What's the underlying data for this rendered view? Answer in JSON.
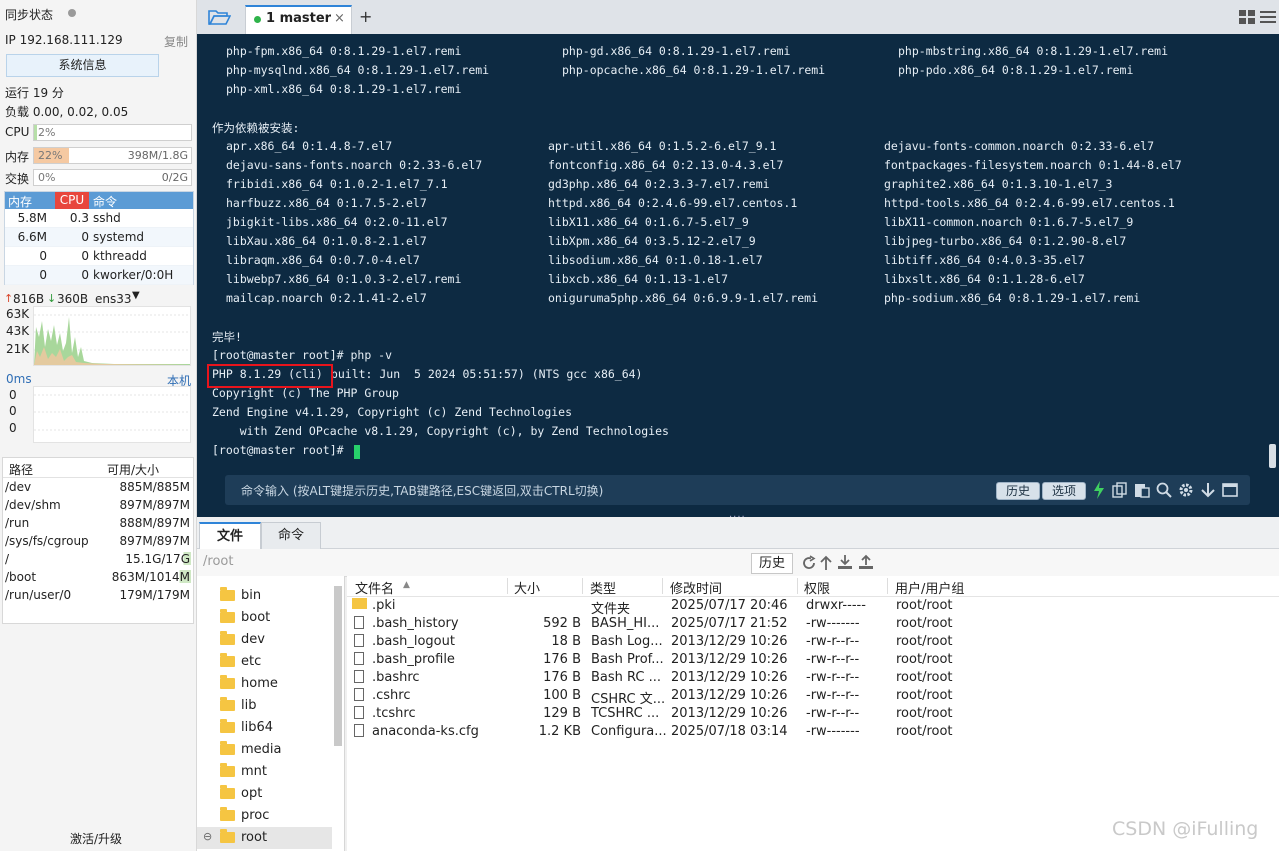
{
  "left": {
    "sync_label": "同步状态",
    "ip": "IP 192.168.111.129",
    "copy": "复制",
    "sysinfo_btn": "系统信息",
    "uptime": "运行 19 分",
    "load": "负载 0.00, 0.02, 0.05",
    "cpu_label": "CPU",
    "cpu_val": "2%",
    "mem_label": "内存",
    "mem_val": "22%",
    "mem_size": "398M/1.8G",
    "swap_label": "交换",
    "swap_val": "0%",
    "swap_size": "0/2G",
    "proc_headers": [
      "内存",
      "CPU",
      "命令"
    ],
    "procs": [
      {
        "mem": "5.8M",
        "cpu": "0.3",
        "cmd": "sshd"
      },
      {
        "mem": "6.6M",
        "cpu": "0",
        "cmd": "systemd"
      },
      {
        "mem": "0",
        "cpu": "0",
        "cmd": "kthreadd"
      },
      {
        "mem": "0",
        "cpu": "0",
        "cmd": "kworker/0:0H"
      }
    ],
    "net_up": "816B",
    "net_down": "360B",
    "net_iface": "ens33",
    "net_ticks": [
      "63K",
      "43K",
      "21K"
    ],
    "lat_label": "0ms",
    "lat_host": "本机",
    "lat_ticks": [
      "0",
      "0",
      "0"
    ],
    "disk_headers": [
      "路径",
      "可用/大小"
    ],
    "disks": [
      {
        "path": "/dev",
        "size": "885M/885M"
      },
      {
        "path": "/dev/shm",
        "size": "897M/897M"
      },
      {
        "path": "/run",
        "size": "888M/897M"
      },
      {
        "path": "/sys/fs/cgroup",
        "size": "897M/897M"
      },
      {
        "path": "/",
        "size": "15.1G/17G"
      },
      {
        "path": "/boot",
        "size": "863M/1014M"
      },
      {
        "path": "/run/user/0",
        "size": "179M/179M"
      }
    ],
    "activate": "激活/升级"
  },
  "tabs": {
    "active_label": "1 master",
    "close": "×",
    "add": "+"
  },
  "terminal": {
    "pkg_rows1": [
      [
        "php-fpm.x86_64 0:8.1.29-1.el7.remi",
        "php-gd.x86_64 0:8.1.29-1.el7.remi",
        "php-mbstring.x86_64 0:8.1.29-1.el7.remi"
      ],
      [
        "php-mysqlnd.x86_64 0:8.1.29-1.el7.remi",
        "php-opcache.x86_64 0:8.1.29-1.el7.remi",
        "php-pdo.x86_64 0:8.1.29-1.el7.remi"
      ],
      [
        "php-xml.x86_64 0:8.1.29-1.el7.remi",
        "",
        ""
      ]
    ],
    "dep_heading": "作为依赖被安装:",
    "dep_rows": [
      [
        "apr.x86_64 0:1.4.8-7.el7",
        "apr-util.x86_64 0:1.5.2-6.el7_9.1",
        "dejavu-fonts-common.noarch 0:2.33-6.el7"
      ],
      [
        "dejavu-sans-fonts.noarch 0:2.33-6.el7",
        "fontconfig.x86_64 0:2.13.0-4.3.el7",
        "fontpackages-filesystem.noarch 0:1.44-8.el7"
      ],
      [
        "fribidi.x86_64 0:1.0.2-1.el7_7.1",
        "gd3php.x86_64 0:2.3.3-7.el7.remi",
        "graphite2.x86_64 0:1.3.10-1.el7_3"
      ],
      [
        "harfbuzz.x86_64 0:1.7.5-2.el7",
        "httpd.x86_64 0:2.4.6-99.el7.centos.1",
        "httpd-tools.x86_64 0:2.4.6-99.el7.centos.1"
      ],
      [
        "jbigkit-libs.x86_64 0:2.0-11.el7",
        "libX11.x86_64 0:1.6.7-5.el7_9",
        "libX11-common.noarch 0:1.6.7-5.el7_9"
      ],
      [
        "libXau.x86_64 0:1.0.8-2.1.el7",
        "libXpm.x86_64 0:3.5.12-2.el7_9",
        "libjpeg-turbo.x86_64 0:1.2.90-8.el7"
      ],
      [
        "libraqm.x86_64 0:0.7.0-4.el7",
        "libsodium.x86_64 0:1.0.18-1.el7",
        "libtiff.x86_64 0:4.0.3-35.el7"
      ],
      [
        "libwebp7.x86_64 0:1.0.3-2.el7.remi",
        "libxcb.x86_64 0:1.13-1.el7",
        "libxslt.x86_64 0:1.1.28-6.el7"
      ],
      [
        "mailcap.noarch 0:2.1.41-2.el7",
        "oniguruma5php.x86_64 0:6.9.9-1.el7.remi",
        "php-sodium.x86_64 0:8.1.29-1.el7.remi"
      ]
    ],
    "done": "完毕!",
    "prompt_cmd": "[root@master root]# php -v",
    "php_highlight": "PHP 8.1.29 (cli)",
    "php_rest": " built: Jun  5 2024 05:51:57) (NTS gcc x86_64)",
    "copyright": "Copyright (c) The PHP Group",
    "zend": "Zend Engine v4.1.29, Copyright (c) Zend Technologies",
    "opcache": "    with Zend OPcache v8.1.29, Copyright (c), by Zend Technologies",
    "prompt": "[root@master root]#",
    "cmd_placeholder": "命令输入 (按ALT键提示历史,TAB键路径,ESC键返回,双击CTRL切换)",
    "history_btn": "历史",
    "options_btn": "选项"
  },
  "bottom": {
    "tabs": [
      "文件",
      "命令"
    ],
    "path": "/root",
    "history_btn": "历史",
    "tree": [
      "bin",
      "boot",
      "dev",
      "etc",
      "home",
      "lib",
      "lib64",
      "media",
      "mnt",
      "opt",
      "proc",
      "root"
    ],
    "columns": [
      "文件名",
      "大小",
      "类型",
      "修改时间",
      "权限",
      "用户/用户组"
    ],
    "files": [
      {
        "name": ".pki",
        "size": "",
        "type": "文件夹",
        "mtime": "2025/07/17 20:46",
        "perm": "drwxr-----",
        "owner": "root/root",
        "folder": true
      },
      {
        "name": ".bash_history",
        "size": "592 B",
        "type": "BASH_HI...",
        "mtime": "2025/07/17 21:52",
        "perm": "-rw-------",
        "owner": "root/root",
        "folder": false
      },
      {
        "name": ".bash_logout",
        "size": "18 B",
        "type": "Bash Log...",
        "mtime": "2013/12/29 10:26",
        "perm": "-rw-r--r--",
        "owner": "root/root",
        "folder": false
      },
      {
        "name": ".bash_profile",
        "size": "176 B",
        "type": "Bash Prof...",
        "mtime": "2013/12/29 10:26",
        "perm": "-rw-r--r--",
        "owner": "root/root",
        "folder": false
      },
      {
        "name": ".bashrc",
        "size": "176 B",
        "type": "Bash RC ...",
        "mtime": "2013/12/29 10:26",
        "perm": "-rw-r--r--",
        "owner": "root/root",
        "folder": false
      },
      {
        "name": ".cshrc",
        "size": "100 B",
        "type": "CSHRC 文...",
        "mtime": "2013/12/29 10:26",
        "perm": "-rw-r--r--",
        "owner": "root/root",
        "folder": false
      },
      {
        "name": ".tcshrc",
        "size": "129 B",
        "type": "TCSHRC ...",
        "mtime": "2013/12/29 10:26",
        "perm": "-rw-r--r--",
        "owner": "root/root",
        "folder": false
      },
      {
        "name": "anaconda-ks.cfg",
        "size": "1.2 KB",
        "type": "Configura...",
        "mtime": "2025/07/18 03:14",
        "perm": "-rw-------",
        "owner": "root/root",
        "folder": false
      }
    ]
  },
  "watermark": "CSDN @iFulling"
}
